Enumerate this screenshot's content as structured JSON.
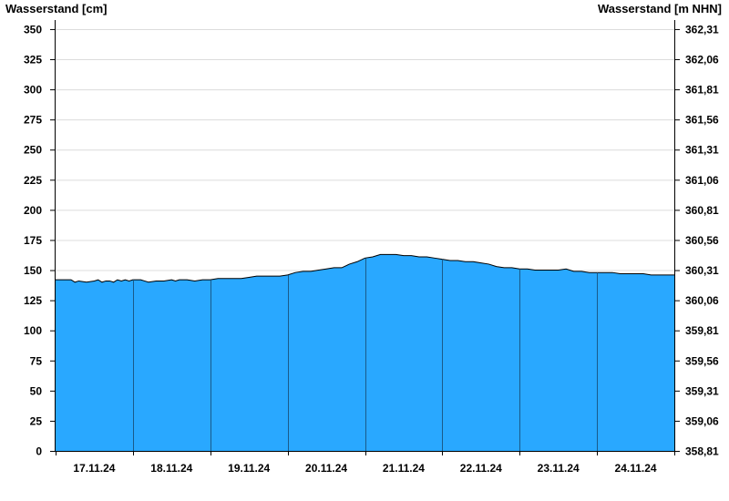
{
  "chart_data": {
    "type": "area",
    "y_left_label": "Wasserstand [cm]",
    "y_right_label": "Wasserstand [m NHN]",
    "y_left_ticks": [
      "0",
      "25",
      "50",
      "75",
      "100",
      "125",
      "150",
      "175",
      "200",
      "225",
      "250",
      "275",
      "300",
      "325",
      "350"
    ],
    "y_right_ticks": [
      "358,81",
      "359,06",
      "359,31",
      "359,56",
      "359,81",
      "360,06",
      "360,31",
      "360,56",
      "360,81",
      "361,06",
      "361,31",
      "361,56",
      "361,81",
      "362,06",
      "362,31"
    ],
    "ylim": [
      0,
      356
    ],
    "x_tick_labels": [
      "17.11.24",
      "18.11.24",
      "19.11.24",
      "20.11.24",
      "21.11.24",
      "22.11.24",
      "23.11.24",
      "24.11.24"
    ],
    "x_range_days": [
      0,
      8
    ],
    "grid": true,
    "fill_color": "#29a8ff",
    "line_color": "#000000",
    "grid_color": "#dcdcdc",
    "series": [
      {
        "x": [
          0,
          0.1,
          0.2,
          0.25,
          0.3,
          0.4,
          0.5,
          0.55,
          0.6,
          0.65,
          0.7,
          0.75,
          0.8,
          0.85,
          0.9,
          0.95,
          1.0,
          1.1,
          1.15,
          1.2,
          1.3,
          1.4,
          1.5,
          1.55,
          1.6,
          1.7,
          1.8,
          1.9,
          2.0,
          2.1,
          2.2,
          2.3,
          2.4,
          2.5,
          2.6,
          2.7,
          2.8,
          2.9,
          3.0,
          3.1,
          3.2,
          3.3,
          3.4,
          3.5,
          3.6,
          3.7,
          3.8,
          3.9,
          4.0,
          4.1,
          4.2,
          4.3,
          4.4,
          4.5,
          4.6,
          4.7,
          4.8,
          4.9,
          5.0,
          5.1,
          5.2,
          5.3,
          5.4,
          5.5,
          5.6,
          5.7,
          5.8,
          5.9,
          6.0,
          6.1,
          6.2,
          6.3,
          6.4,
          6.5,
          6.6,
          6.7,
          6.8,
          6.9,
          7.0,
          7.1,
          7.2,
          7.3,
          7.4,
          7.5,
          7.6,
          7.7,
          7.8,
          7.9,
          8.0
        ],
        "values": [
          142,
          142,
          142,
          140,
          141,
          140,
          141,
          142,
          140,
          141,
          141,
          140,
          142,
          141,
          142,
          141,
          142,
          142,
          141,
          140,
          141,
          141,
          142,
          141,
          142,
          142,
          141,
          142,
          142,
          143,
          143,
          143,
          143,
          144,
          145,
          145,
          145,
          145,
          146,
          148,
          149,
          149,
          150,
          151,
          152,
          152,
          155,
          157,
          160,
          161,
          163,
          163,
          163,
          162,
          162,
          161,
          161,
          160,
          159,
          158,
          158,
          157,
          157,
          156,
          155,
          153,
          152,
          152,
          151,
          151,
          150,
          150,
          150,
          150,
          151,
          149,
          149,
          148,
          148,
          148,
          148,
          147,
          147,
          147,
          147,
          146,
          146,
          146,
          146
        ]
      }
    ]
  }
}
